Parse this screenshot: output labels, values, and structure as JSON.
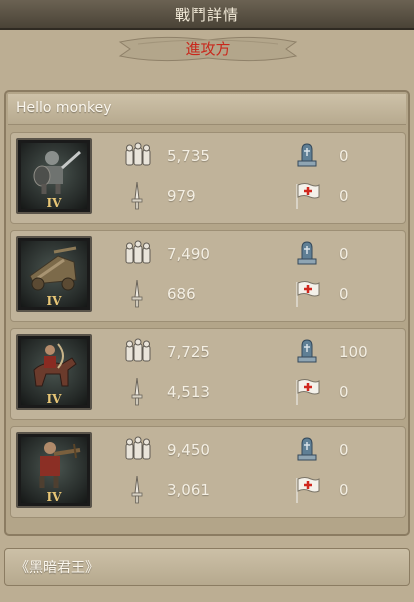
{
  "header": {
    "title": "戰鬥詳情"
  },
  "banner": {
    "label": "進攻方"
  },
  "attacker": {
    "player_name": "Hello monkey",
    "units": [
      {
        "tier": "IV",
        "portrait": "swordsman-portrait",
        "troops": "5,735",
        "kills": "979",
        "dead": "0",
        "wounded": "0"
      },
      {
        "tier": "IV",
        "portrait": "siege-catapult-portrait",
        "troops": "7,490",
        "kills": "686",
        "dead": "0",
        "wounded": "0"
      },
      {
        "tier": "IV",
        "portrait": "horse-archer-portrait",
        "troops": "7,725",
        "kills": "4,513",
        "dead": "100",
        "wounded": "0"
      },
      {
        "tier": "IV",
        "portrait": "crossbowman-portrait",
        "troops": "9,450",
        "kills": "3,061",
        "dead": "0",
        "wounded": "0"
      }
    ]
  },
  "next_section": {
    "label": "《黑暗君王》"
  },
  "icons": {
    "troops": "soldiers-group-icon",
    "kills": "sword-icon",
    "dead": "gravestone-icon",
    "wounded": "red-cross-flag-icon"
  },
  "colors": {
    "banner_text": "#c8281c",
    "tier_text": "#e8c676",
    "value_text": "#f4efe3"
  }
}
